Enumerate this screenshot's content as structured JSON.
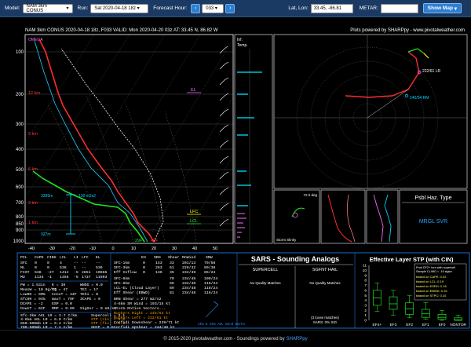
{
  "topbar": {
    "model_label": "Model:",
    "model_value": "NAM 3km CONUS",
    "run_label": "Run:",
    "run_value": "Sat 2020-04-18 18z",
    "forecast_label": "Forecast Hour:",
    "forecast_value": "033",
    "prev_icon": "chevron-left-icon",
    "next_icon": "chevron-right-icon",
    "latlon_label": "Lat, Lon:",
    "latlon_value": "33.45, -86.81",
    "metar_label": "METAR:",
    "metar_value": "",
    "showmap_label": "Show Map",
    "showmap_icon": "chevron-down-icon"
  },
  "header": {
    "title": "NAM 3km CONUS 2020-04-18 18z, F033    VALID: Mon 2020-04-20 03z    AT: 33.45 N, 86.82 W",
    "credit": "Plots powered by SHARPpy - www.pivotalweather.com"
  },
  "skewt": {
    "pressure_labels": [
      "100",
      "200",
      "300",
      "400",
      "500",
      "600",
      "700",
      "800",
      "850",
      "900",
      "1000"
    ],
    "height_labels": [
      "12 km",
      "9 km",
      "6 km",
      "3 km",
      "1 km"
    ],
    "temp_labels": [
      "-40",
      "-30",
      "-20",
      "-10",
      "0",
      "10",
      "20",
      "30",
      "40",
      "50"
    ],
    "annotations": {
      "omega": "OMEGA",
      "lfc": "LFC",
      "lcl": "LCL",
      "el": "EL",
      "sfc_temp": "49F",
      "sfc_dew": "29F",
      "eff": "3395m",
      "mean": "139 m2s2",
      "sfc_height": "927m"
    },
    "side_labels": {
      "inf": "Inf.",
      "temp": "Temp."
    }
  },
  "hodograph": {
    "labels": [
      "222/61 LR",
      "240/54 RM"
    ]
  },
  "hazard": {
    "title": "Psbl Haz. Type",
    "value": "MRGL SVR"
  },
  "small_panels": {
    "deg_label": "72.0 deg",
    "storm_slinky": "Storm Slinky",
    "temps_label": "Temp (F)"
  },
  "params": {
    "table_headers": [
      "PCL",
      "CAPE",
      "CINH",
      "LCL",
      "LI",
      "LFC",
      "EL"
    ],
    "table_rows": [
      [
        "SFC",
        "0",
        "0",
        "4",
        "--",
        "--",
        "--"
      ],
      [
        "ML",
        "0",
        "0",
        "536",
        "1",
        "--",
        "536"
      ],
      [
        "FCST",
        "538",
        "-27",
        "1414",
        "-5",
        "2851",
        "10665"
      ],
      [
        "MU",
        "1134",
        "-1",
        "1456",
        "-5",
        "1737",
        "11993"
      ]
    ],
    "misc_left": [
      "PW = 1.53in",
      "MeanW = 10.9g/kg",
      "LowRH = 90%",
      "SfcRH = 94%",
      "DCAPE = -2",
      "DownT = 62F"
    ],
    "misc_mid": [
      "K = 38",
      "TT = 47",
      "ConvT = 44F",
      "maxT = 79F",
      "ESP = 0.0",
      "MMP = 0.99"
    ],
    "misc_right": [
      "WNDG = 0.0",
      "TEI = 17",
      "TEhi = 0",
      "3CAPE = 0",
      "SigSvr = 0 m3/s3"
    ],
    "lapse": [
      "Sfc-3km AGL LR = 3.7 C/km",
      "3-6km AGL LR = 6.9 C/km",
      "850-500mb LR = 6.4 C/km",
      "700-500mb LR = 7.1 C/km"
    ],
    "composite": [
      "Supercell = 3.1",
      "STP (cin) = 0.0",
      "STP (fix) = 0.0",
      "SHIP = 0.6"
    ]
  },
  "kinematics": {
    "headers": [
      "",
      "EH",
      "SRH",
      "Shear",
      "MnWind",
      "SRW"
    ],
    "rows": [
      [
        "SFC-1km",
        "0",
        "143",
        "33",
        "201/13",
        "79/56"
      ],
      [
        "SFC-3km",
        "0",
        "253",
        "61",
        "228/32",
        "89/36"
      ],
      [
        "Eff Inflow",
        "0",
        "139",
        "35",
        "234/49",
        "85/24"
      ],
      [
        "SFC-6km",
        "",
        "",
        "79",
        "234/45",
        "100/24"
      ],
      [
        "SFC-8km",
        "",
        "",
        "86",
        "234/48",
        "116/24"
      ],
      [
        "LCL-EL (Cloud Layer)",
        "",
        "",
        "89",
        "234/48",
        "116/24"
      ],
      [
        "Eff Shear (EBWD)",
        "",
        "",
        "81",
        "234/48",
        "116/24"
      ]
    ],
    "extra": [
      "BRN Shear = 277 m2/s2",
      "4-6km SR Wind = 193/15 kt"
    ],
    "vectors_title": "Storm Motion Vectors...",
    "vectors": [
      "Bunkers Right = 245/63 kt",
      "Bunkers Left = 222/61 kt",
      "Corfidi Downshear = 239/71 kt",
      "Corfidi Upshear = 244/48 kt"
    ],
    "wind_barb_caption": "1km & 6km AGL Wind Barbs"
  },
  "sars": {
    "title": "SARS - Sounding Analogs",
    "supercell_label": "SUPERCELL",
    "hail_label": "SGFNT HAIL",
    "supercell_result": "No Quality Matches",
    "hail_result": "No Quality Matches",
    "loose": "(3 loose matches)",
    "sig": "SARS: 0% SIG"
  },
  "stp": {
    "title": "Effective Layer STP (with CIN)",
    "legend_title": "Prob EF2+ torn with supercell",
    "legend_subtitle": "Sample CLIMO = .15 sigtor",
    "legend": [
      "based on CAPE: 0.02",
      "based on LCL: 0.19",
      "based on ESRH: 0.16",
      "based on EBWD: 0.16",
      "based on STPC: 0.10"
    ],
    "y_ticks": [
      "11",
      "10",
      "9",
      "8",
      "7",
      "6",
      "5",
      "4",
      "3",
      "2",
      "1",
      "0"
    ],
    "categories": [
      "EF4+",
      "EF3",
      "EF2",
      "EF1",
      "EF0",
      "NONTOR"
    ]
  },
  "chart_data": {
    "type": "bar",
    "title": "Effective Layer STP (with CIN)",
    "categories": [
      "EF4+",
      "EF3",
      "EF2",
      "EF1",
      "EF0",
      "NONTOR"
    ],
    "series": [
      {
        "name": "90th",
        "values": [
          7.5,
          6.0,
          5.0,
          3.5,
          2.0,
          1.0
        ]
      },
      {
        "name": "75th",
        "values": [
          6.0,
          4.7,
          3.5,
          2.2,
          1.2,
          0.5
        ]
      },
      {
        "name": "50th",
        "values": [
          4.5,
          3.3,
          2.3,
          1.3,
          0.6,
          0.1
        ]
      },
      {
        "name": "25th",
        "values": [
          3.0,
          2.2,
          1.2,
          0.6,
          0.2,
          0.0
        ]
      },
      {
        "name": "10th",
        "values": [
          1.8,
          1.0,
          0.5,
          0.2,
          0.0,
          0.0
        ]
      }
    ],
    "ylim": [
      0,
      11
    ]
  },
  "footer": {
    "text": "© 2015-2020 pivotalweather.com - Soundings powered by",
    "brand": "SHARPpy"
  },
  "colors": {
    "temp": "#ff2d2d",
    "dew": "#21e021",
    "parcel": "#ffffff",
    "stp_box": "#22dd22",
    "sars_title": "#ffffff"
  }
}
